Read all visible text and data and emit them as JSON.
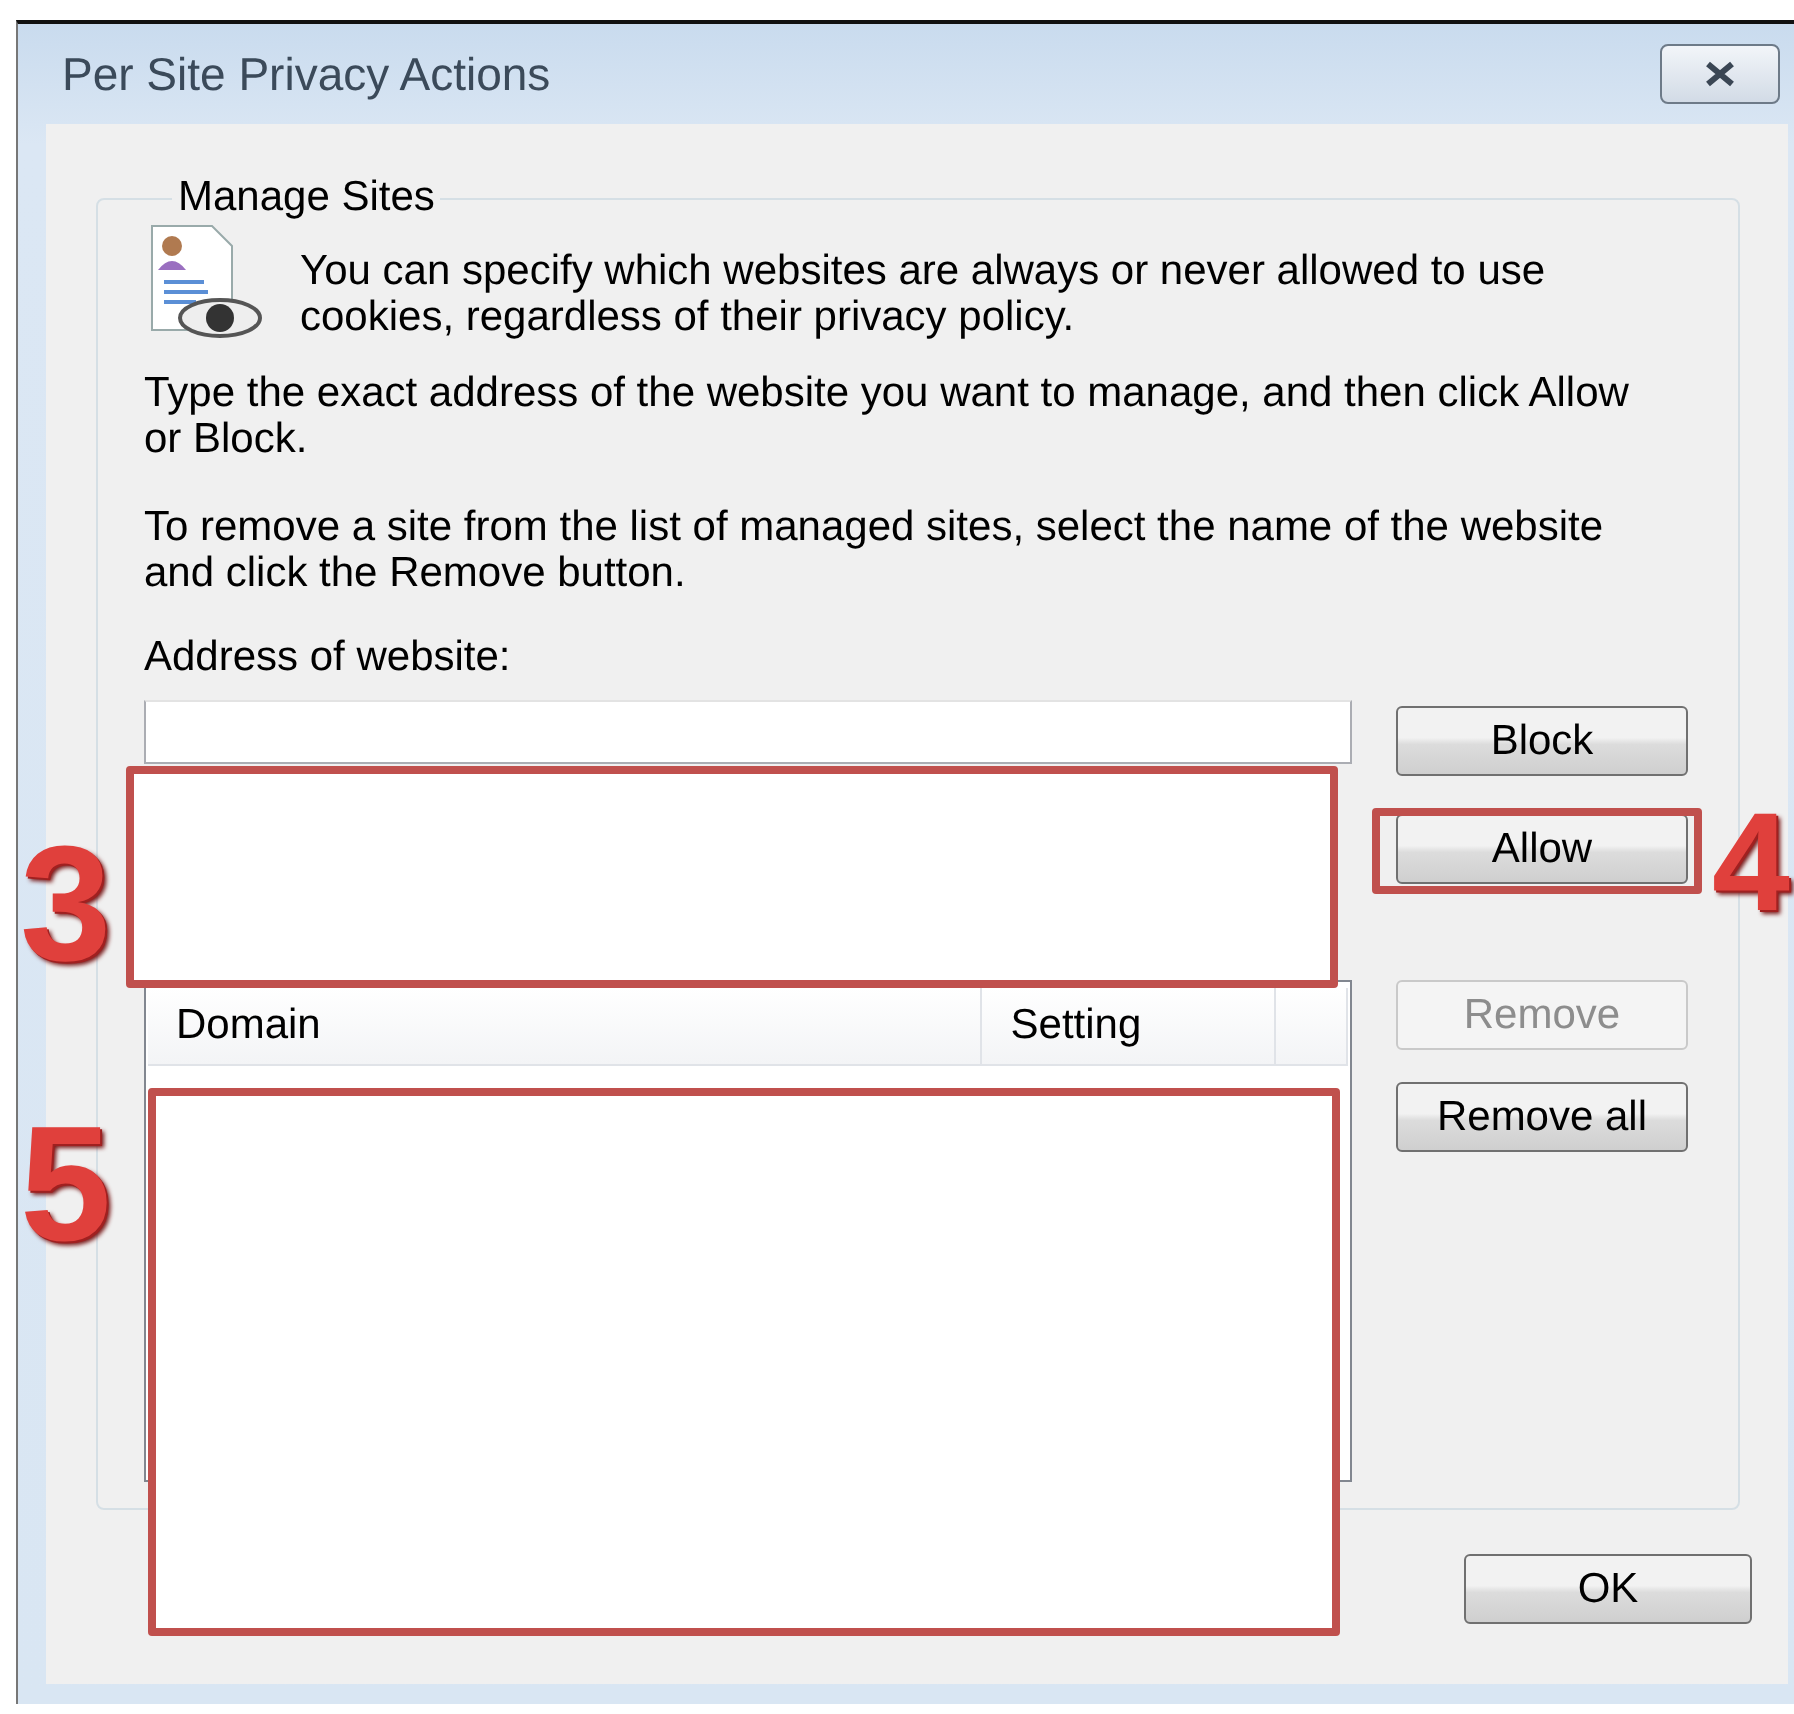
{
  "window": {
    "title": "Per Site Privacy Actions"
  },
  "group": {
    "title": "Manage Sites",
    "intro": "You can specify which websites are always or never allowed to use cookies, regardless of their privacy policy.",
    "paragraphs": [
      "Type the exact address of the website you want to manage, and then click Allow or Block.",
      "To remove a site from the list of managed sites, select the name of the website and click the Remove button."
    ],
    "address": {
      "label": "Address of website:"
    },
    "buttons": [
      {
        "label": "Block",
        "disabled": false
      },
      {
        "label": "Allow",
        "disabled": false
      },
      {
        "label": "Remove",
        "disabled": true
      },
      {
        "label": "Remove all",
        "disabled": false
      }
    ],
    "list": {
      "columns": [
        "Domain",
        "Setting"
      ]
    }
  },
  "ok_button": {
    "label": "OK"
  },
  "annotations": [
    {
      "label": "3",
      "filled": true
    },
    {
      "label": "4",
      "filled": false
    },
    {
      "label": "5",
      "filled": true
    }
  ]
}
